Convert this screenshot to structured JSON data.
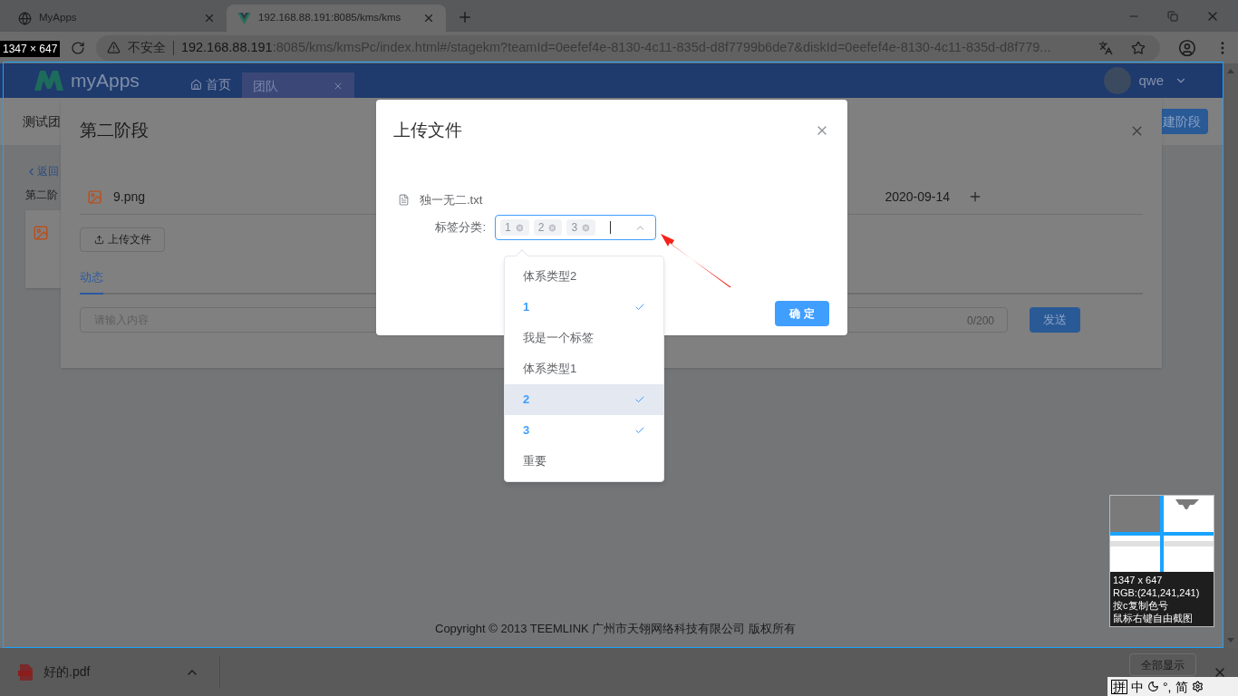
{
  "browser": {
    "tabs": [
      {
        "title": "MyApps",
        "selected": false
      },
      {
        "title": "192.168.88.191:8085/kms/kms",
        "selected": true
      }
    ],
    "security_label": "不安全",
    "url_host": "192.168.88.191",
    "url_rest": ":8085/kms/kmsPc/index.html#/stagekm?teamId=0eefef4e-8130-4c11-835d-d8f7799b6de7&diskId=0eefef4e-8130-4c11-835d-d8f779..."
  },
  "app": {
    "logo": "myApps",
    "nav": [
      {
        "label": "首页",
        "selected": false
      },
      {
        "label": "团队",
        "selected": true
      }
    ],
    "user": "qwe"
  },
  "page": {
    "team_title": "测试团",
    "back_link": "返回",
    "stage_label": "第二阶",
    "create_stage_button": "建阶段",
    "footer": "Copyright © 2013 TEEMLINK 广州市天翎网络科技有限公司 版权所有"
  },
  "stage_dialog": {
    "title": "第二阶段",
    "file": {
      "name": "9.png",
      "date": "2020-09-14"
    },
    "upload_button": "上传文件",
    "tabs": [
      {
        "label": "动态",
        "selected": true
      }
    ],
    "comment": {
      "placeholder": "请输入内容",
      "counter": "0/200"
    },
    "send_button": "发送"
  },
  "upload_dialog": {
    "title": "上传文件",
    "file": "独一无二.txt",
    "tag_label": "标签分类:",
    "tags": [
      "1",
      "2",
      "3"
    ],
    "confirm_button": "确 定"
  },
  "dropdown": {
    "options": [
      {
        "label": "体系类型2",
        "selected": false,
        "hovered": false
      },
      {
        "label": "1",
        "selected": true,
        "hovered": false
      },
      {
        "label": "我是一个标签",
        "selected": false,
        "hovered": false
      },
      {
        "label": "体系类型1",
        "selected": false,
        "hovered": false
      },
      {
        "label": "2",
        "selected": true,
        "hovered": true
      },
      {
        "label": "3",
        "selected": true,
        "hovered": false
      },
      {
        "label": "重要",
        "selected": false,
        "hovered": false
      }
    ]
  },
  "download_bar": {
    "file": "好的.pdf",
    "show_all_button": "全部显示"
  },
  "capture_tool": {
    "size_label": "1347 × 647",
    "info": [
      "1347 x 647",
      "RGB:(241,241,241)",
      "按c复制色号",
      "鼠标右键自由截图"
    ]
  },
  "ime_bar": {
    "items": [
      "拼",
      "中",
      "°,",
      "简"
    ]
  }
}
